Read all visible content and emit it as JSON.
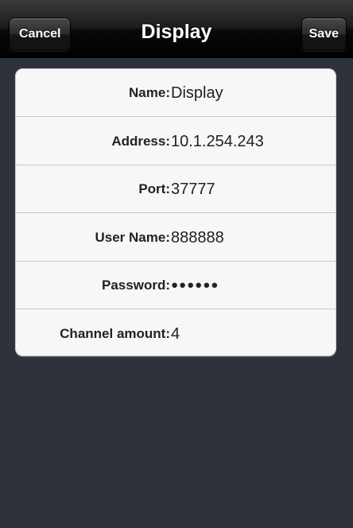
{
  "navbar": {
    "title": "Display",
    "cancel_label": "Cancel",
    "save_label": "Save"
  },
  "form": {
    "rows": [
      {
        "label": "Name:",
        "value": "Display"
      },
      {
        "label": "Address:",
        "value": "10.1.254.243"
      },
      {
        "label": "Port:",
        "value": "37777"
      },
      {
        "label": "User Name:",
        "value": "888888"
      },
      {
        "label": "Password:",
        "value": "●●●●●●"
      },
      {
        "label": "Channel amount:",
        "value": "4"
      }
    ]
  },
  "colors": {
    "navbar": "#1c1c1e",
    "background": "#2c313a",
    "card": "#f7f7f7",
    "text": "#222222"
  }
}
